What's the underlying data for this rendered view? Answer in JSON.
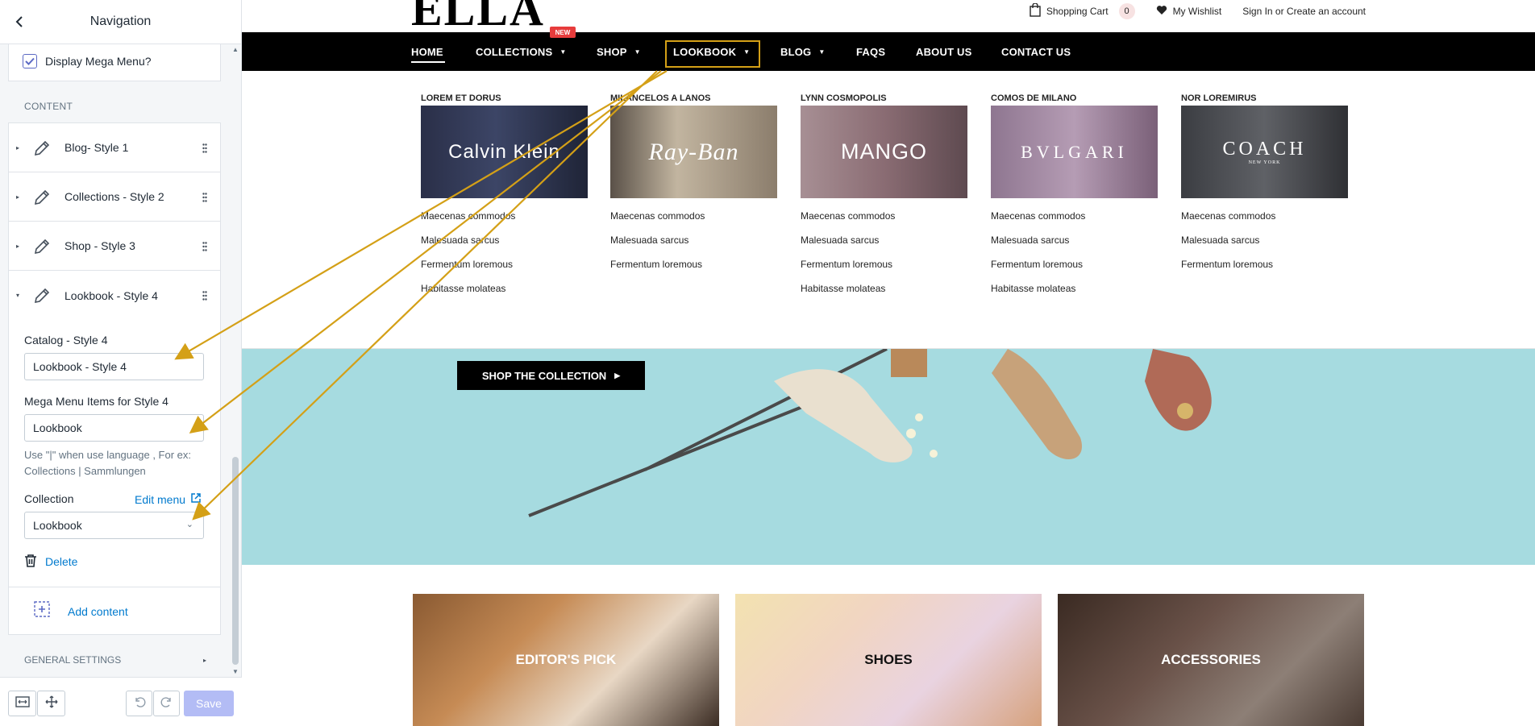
{
  "sidebar": {
    "title": "Navigation",
    "display_mega_menu": "Display Mega Menu?",
    "content_label": "CONTENT",
    "items": [
      {
        "label": "Blog- Style 1"
      },
      {
        "label": "Collections - Style 2"
      },
      {
        "label": "Shop - Style 3"
      },
      {
        "label": "Lookbook - Style 4"
      }
    ],
    "catalog_label": "Catalog - Style 4",
    "catalog_value": "Lookbook - Style 4",
    "mega_items_label": "Mega Menu Items for Style 4",
    "mega_items_value": "Lookbook",
    "hint": "Use \"|\" when use language , For ex: Collections | Sammlungen",
    "collection_label": "Collection",
    "edit_menu": "Edit menu",
    "collection_value": "Lookbook",
    "delete": "Delete",
    "add_content": "Add content",
    "general_settings": "GENERAL SETTINGS",
    "save": "Save"
  },
  "store": {
    "logo": "ELLA",
    "topbar": {
      "cart": "Shopping Cart",
      "cart_count": "0",
      "wishlist": "My Wishlist",
      "account": "Sign In or Create an account"
    },
    "nav": [
      {
        "label": "HOME"
      },
      {
        "label": "COLLECTIONS"
      },
      {
        "label": "SHOP"
      },
      {
        "label": "LOOKBOOK"
      },
      {
        "label": "BLOG"
      },
      {
        "label": "FAQS"
      },
      {
        "label": "ABOUT US"
      },
      {
        "label": "CONTACT US"
      }
    ],
    "new_badge": "NEW",
    "mega_columns": [
      {
        "heading": "LOREM ET DORUS",
        "brand": "Calvin Klein",
        "links": [
          "Maecenas commodos",
          "Malesuada sarcus",
          "Fermentum loremous",
          "Habitasse molateas"
        ]
      },
      {
        "heading": "MILANCELOS A LANOS",
        "brand": "Ray-Ban",
        "links": [
          "Maecenas commodos",
          "Malesuada sarcus",
          "Fermentum loremous"
        ]
      },
      {
        "heading": "LYNN COSMOPOLIS",
        "brand": "MANGO",
        "links": [
          "Maecenas commodos",
          "Malesuada sarcus",
          "Fermentum loremous",
          "Habitasse molateas"
        ]
      },
      {
        "heading": "COMOS DE MILANO",
        "brand": "BVLGARI",
        "links": [
          "Maecenas commodos",
          "Malesuada sarcus",
          "Fermentum loremous",
          "Habitasse molateas"
        ]
      },
      {
        "heading": "NOR LOREMIRUS",
        "brand": "COACH",
        "brand_sub": "NEW YORK",
        "links": [
          "Maecenas commodos",
          "Malesuada sarcus",
          "Fermentum loremous"
        ]
      }
    ],
    "shop_button": "SHOP THE COLLECTION",
    "categories": [
      {
        "label": "EDITOR'S PICK"
      },
      {
        "label": "SHOES"
      },
      {
        "label": "ACCESSORIES"
      }
    ]
  },
  "colors": {
    "accent": "#5c6ac4",
    "annotation": "#d4a017",
    "hero_bg": "#a6dbe0",
    "badge": "#e73c3c"
  }
}
